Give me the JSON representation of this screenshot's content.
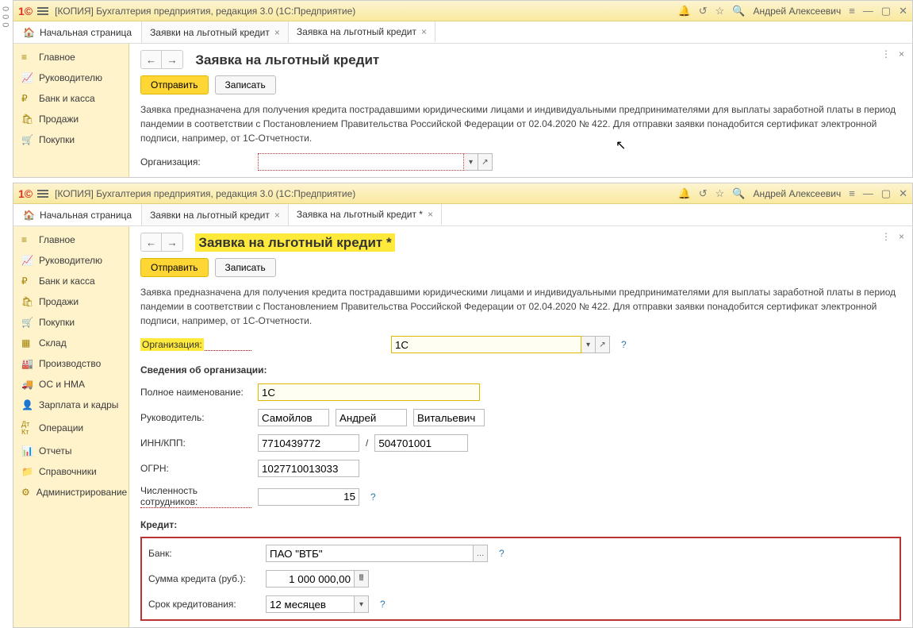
{
  "left_margin": "000",
  "app": {
    "title": "[КОПИЯ] Бухгалтерия предприятия, редакция 3.0  (1С:Предприятие)",
    "user": "Андрей Алексеевич"
  },
  "tabs": {
    "home": "Начальная страница",
    "tab1": "Заявки на льготный кредит",
    "tab2_top": "Заявка на льготный кредит",
    "tab2_bottom": "Заявка на льготный кредит *"
  },
  "sidebar_top": [
    {
      "icon": "★",
      "label": "Главное"
    },
    {
      "icon": "📈",
      "label": "Руководителю"
    },
    {
      "icon": "₽",
      "label": "Банк и касса"
    },
    {
      "icon": "🛍",
      "label": "Продажи"
    },
    {
      "icon": "🛒",
      "label": "Покупки"
    }
  ],
  "sidebar_bottom": [
    {
      "icon": "★",
      "label": "Главное"
    },
    {
      "icon": "📈",
      "label": "Руководителю"
    },
    {
      "icon": "₽",
      "label": "Банк и касса"
    },
    {
      "icon": "🛍",
      "label": "Продажи"
    },
    {
      "icon": "🛒",
      "label": "Покупки"
    },
    {
      "icon": "≡",
      "label": "Склад"
    },
    {
      "icon": "🏭",
      "label": "Производство"
    },
    {
      "icon": "🚚",
      "label": "ОС и НМА"
    },
    {
      "icon": "👤",
      "label": "Зарплата и кадры"
    },
    {
      "icon": "Дт",
      "label": "Операции"
    },
    {
      "icon": "📊",
      "label": "Отчеты"
    },
    {
      "icon": "📁",
      "label": "Справочники"
    },
    {
      "icon": "⚙",
      "label": "Администрирование"
    }
  ],
  "page": {
    "title_top": "Заявка на льготный кредит",
    "title_bottom": "Заявка на льготный кредит *",
    "send": "Отправить",
    "save": "Записать",
    "desc": "Заявка предназначена для получения кредита пострадавшими юридическими лицами и индивидуальными предпринимателями для выплаты заработной платы в период пандемии в соответствии с Постановлением Правительства Российской Федерации от 02.04.2020 № 422. Для отправки заявки понадобится сертификат электронной подписи, например, от 1С-Отчетности.",
    "org_label": "Организация:"
  },
  "form": {
    "org_value": "1С",
    "section_org": "Сведения об организации:",
    "fullname_label": "Полное наименование:",
    "fullname_value": "1С",
    "director_label": "Руководитель:",
    "dir_last": "Самойлов",
    "dir_first": "Андрей",
    "dir_mid": "Витальевич",
    "inn_label": "ИНН/КПП:",
    "inn_value": "7710439772",
    "kpp_value": "504701001",
    "inn_sep": "/",
    "ogrn_label": "ОГРН:",
    "ogrn_value": "1027710013033",
    "emp_label": "Численность сотрудников:",
    "emp_value": "15",
    "section_credit": "Кредит:",
    "bank_label": "Банк:",
    "bank_value": "ПАО \"ВТБ\"",
    "sum_label": "Сумма кредита (руб.):",
    "sum_value": "1 000 000,00",
    "term_label": "Срок кредитования:",
    "term_value": "12 месяцев"
  }
}
